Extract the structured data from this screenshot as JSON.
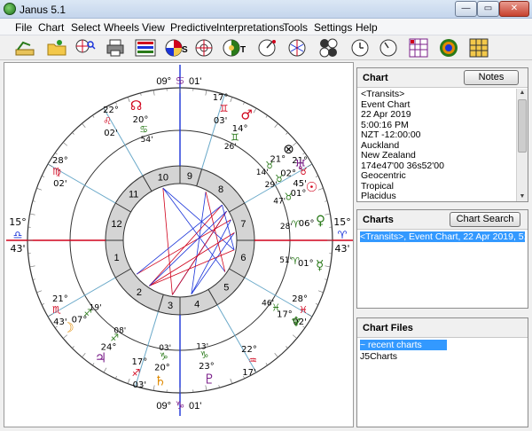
{
  "window": {
    "title": "Janus 5.1",
    "controls": [
      "—",
      "▭",
      "✕"
    ]
  },
  "menu": [
    "File",
    "Chart",
    "Select",
    "Wheels",
    "View",
    "Predictive",
    "Interpretations",
    "Tools",
    "Settings",
    "Help"
  ],
  "toolbar": {
    "suffixes": {
      "s": "S",
      "t": "T"
    },
    "icons": [
      "open-chart-icon",
      "open-folder-icon",
      "search-chart-icon",
      "print-icon",
      "chart-data-icon",
      "wheel-s-icon",
      "wheel-icon",
      "wheel-t-icon",
      "dial-icon",
      "aspect-grid-icon",
      "wheel-color-icon",
      "clock-icon",
      "time-icon",
      "calendar-grid-icon",
      "target-icon",
      "grid-icon"
    ]
  },
  "colors": {
    "red": "#d0021b",
    "blue": "#1a33d9",
    "green": "#2a7a1a",
    "purple": "#7b1f8a",
    "orange": "#e08a00"
  },
  "chart_panel": {
    "title": "Chart",
    "notes_button": "Notes",
    "info": [
      "<Transits>",
      "Event Chart",
      "22 Apr 2019",
      "5:00:16 PM",
      "NZT -12:00:00",
      "Auckland",
      "New Zealand",
      "174e47'00 36s52'00",
      "Geocentric",
      "Tropical",
      "Placidus"
    ]
  },
  "charts_panel": {
    "title": "Charts",
    "search_button": "Chart Search",
    "items": [
      "<Transits>,  Event Chart, 22 Apr 2019, 5:00:16"
    ]
  },
  "files_panel": {
    "title": "Chart Files",
    "items": [
      "~ recent charts",
      "J5Charts"
    ]
  },
  "wheel": {
    "houses": [
      "1",
      "2",
      "3",
      "4",
      "5",
      "6",
      "7",
      "8",
      "9",
      "10",
      "11",
      "12"
    ],
    "cusps": [
      {
        "deg": "15°",
        "sign": "♎",
        "min": "43'"
      },
      {
        "deg": "21°",
        "sign": "♏",
        "min": "43'"
      },
      {
        "deg": "17°",
        "sign": "♐",
        "min": "03'"
      },
      {
        "deg": "09°",
        "sign": "♑",
        "min": "01'"
      },
      {
        "deg": "22°",
        "sign": "♒",
        "min": "17'"
      },
      {
        "deg": "28°",
        "sign": "♓",
        "min": "02'"
      },
      {
        "deg": "15°",
        "sign": "♈",
        "min": "43'"
      },
      {
        "deg": "21°",
        "sign": "♉",
        "min": "45'"
      },
      {
        "deg": "17°",
        "sign": "♊",
        "min": "03'"
      },
      {
        "deg": "09°",
        "sign": "♋",
        "min": "01'"
      },
      {
        "deg": "22°",
        "sign": "♌",
        "min": "02'"
      },
      {
        "deg": "28°",
        "sign": "♍",
        "min": "02'"
      }
    ],
    "planets": [
      {
        "glyph": "☊",
        "deg": "20°",
        "sign": "♋",
        "min": "54'"
      },
      {
        "glyph": "♂",
        "deg": "14°",
        "sign": "♊",
        "min": "26'"
      },
      {
        "glyph": "⊗",
        "deg": "21°",
        "sign": "♉",
        "min": "14'"
      },
      {
        "glyph": "♅",
        "deg": "02°",
        "sign": "♉",
        "min": "29'"
      },
      {
        "glyph": "☉",
        "deg": "01°",
        "sign": "♉",
        "min": "47'"
      },
      {
        "glyph": "♀",
        "deg": "06°",
        "sign": "♈",
        "min": "28'"
      },
      {
        "glyph": "☿",
        "deg": "01°",
        "sign": "♈",
        "min": "51'"
      },
      {
        "glyph": "♆",
        "deg": "17°",
        "sign": "♓",
        "min": "46'"
      },
      {
        "glyph": "♄",
        "deg": "20°",
        "sign": "♑",
        "min": "03'"
      },
      {
        "glyph": "♇",
        "deg": "23°",
        "sign": "♑",
        "min": "13'"
      },
      {
        "glyph": "♃",
        "deg": "24°",
        "sign": "♐",
        "min": "08'"
      },
      {
        "glyph": "☽",
        "deg": "07°",
        "sign": "♐",
        "min": "19'"
      }
    ]
  }
}
